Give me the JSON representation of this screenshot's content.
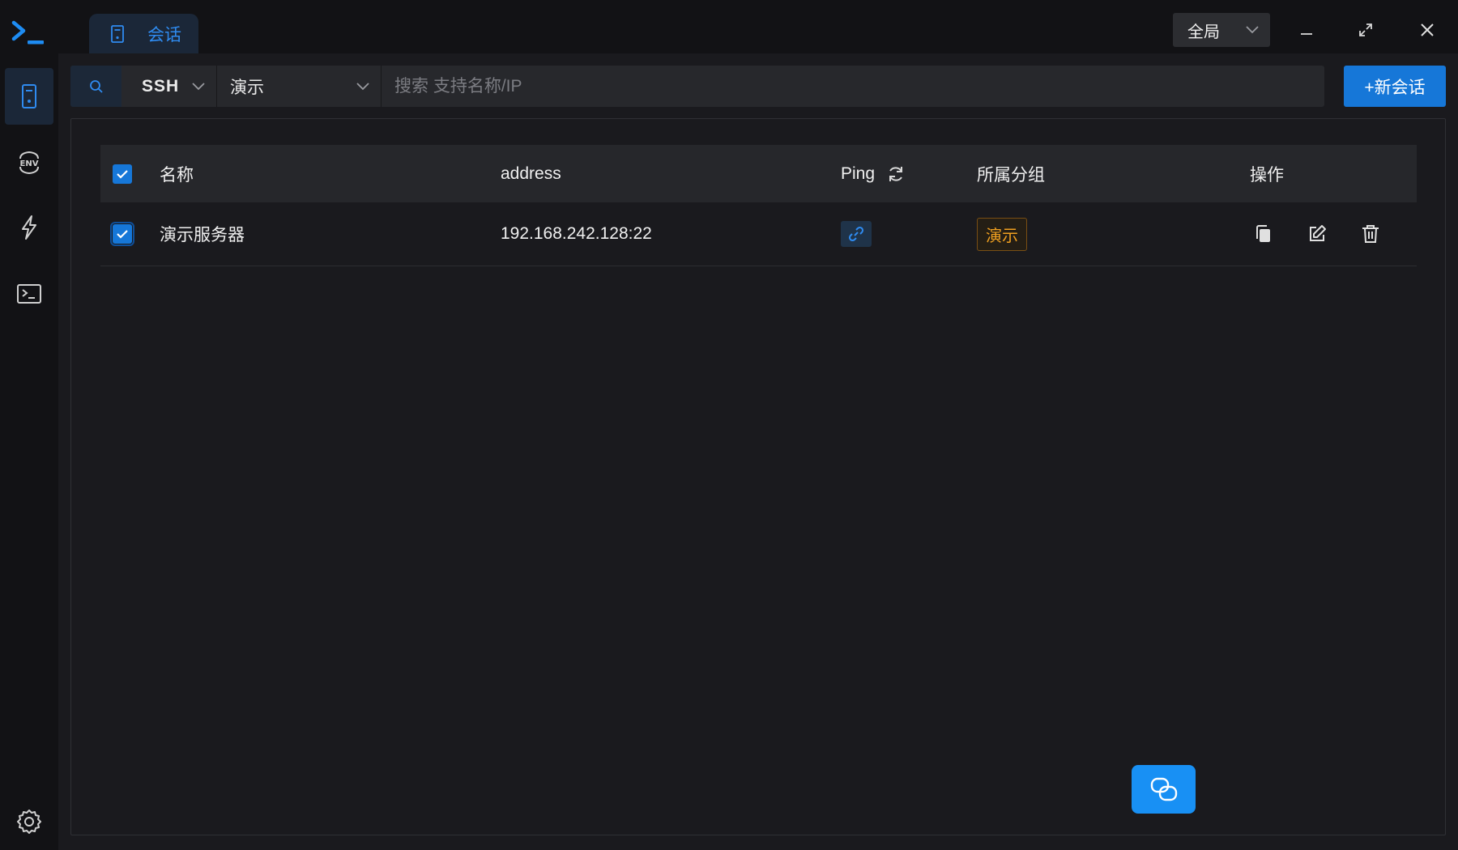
{
  "titlebar": {
    "tab_label": "会话",
    "scope_value": "全局"
  },
  "search": {
    "protocol_value": "SSH",
    "group_value": "演示",
    "placeholder": "搜索 支持名称/IP",
    "new_session_label": "+新会话"
  },
  "table": {
    "headers": {
      "name": "名称",
      "address": "address",
      "ping": "Ping",
      "group": "所属分组",
      "actions": "操作"
    },
    "rows": [
      {
        "name": "演示服务器",
        "address": "192.168.242.128:22",
        "group": "演示",
        "checked": true
      }
    ]
  },
  "colors": {
    "accent": "#1677d8",
    "tag_orange": "#f0a020",
    "background": "#1a1a1e"
  }
}
